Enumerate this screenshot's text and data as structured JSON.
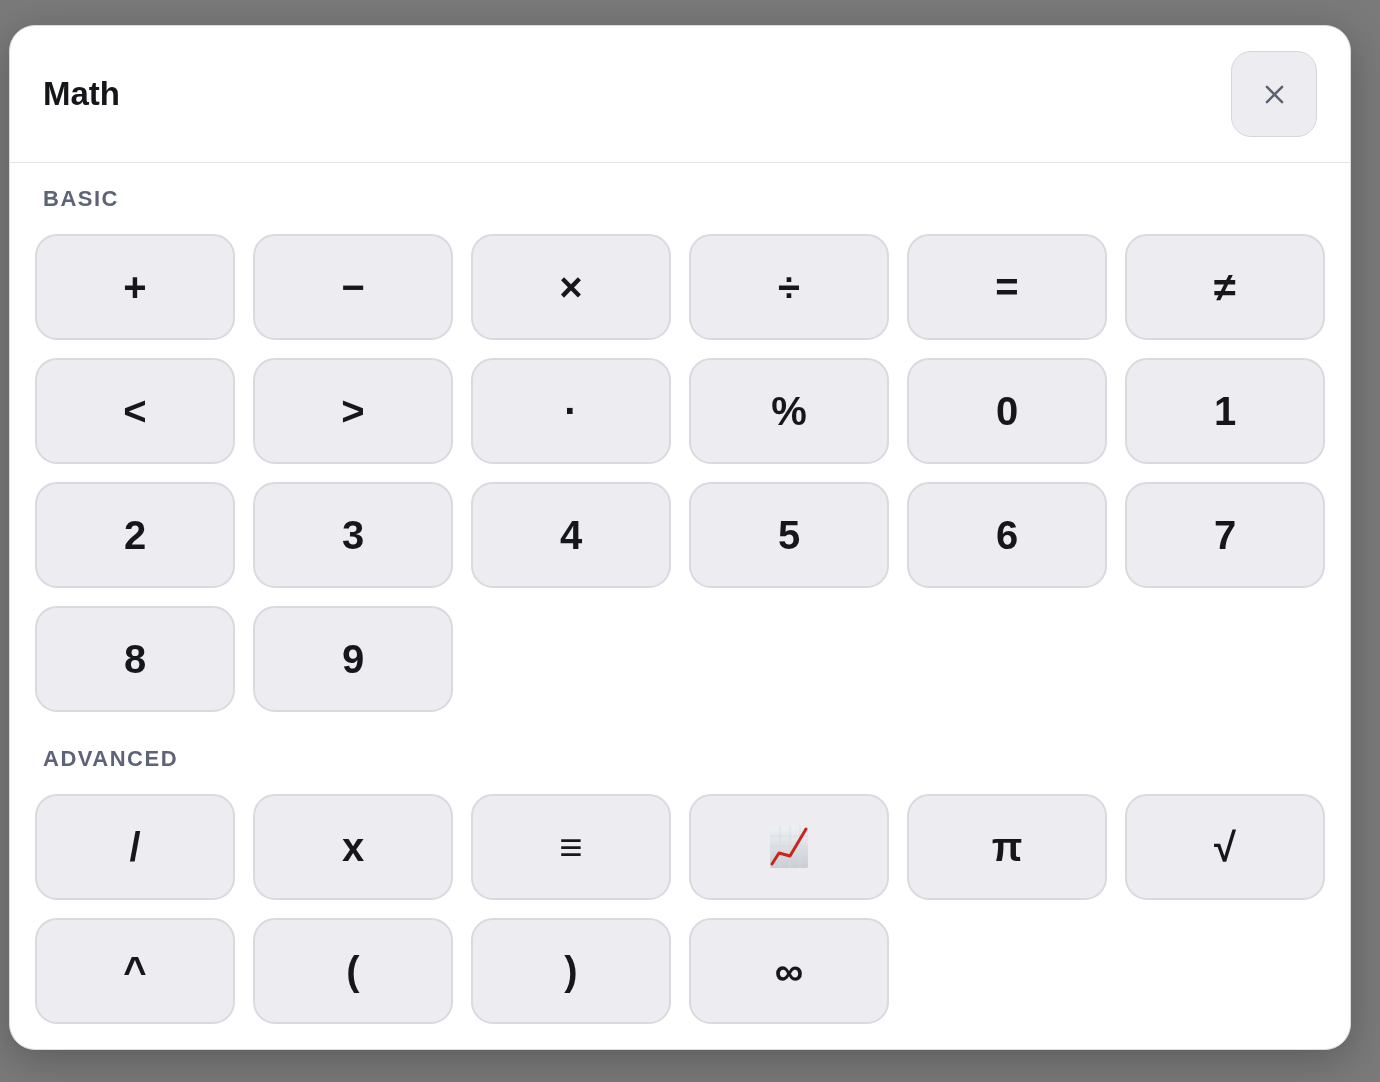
{
  "dialog": {
    "title": "Math"
  },
  "sections": [
    {
      "heading": "BASIC",
      "keys": [
        {
          "kind": "text",
          "label": "+"
        },
        {
          "kind": "text",
          "label": "−"
        },
        {
          "kind": "text",
          "label": "×"
        },
        {
          "kind": "text",
          "label": "÷"
        },
        {
          "kind": "text",
          "label": "="
        },
        {
          "kind": "text",
          "label": "≠"
        },
        {
          "kind": "text",
          "label": "<"
        },
        {
          "kind": "text",
          "label": ">"
        },
        {
          "kind": "text",
          "label": "·"
        },
        {
          "kind": "text",
          "label": "%"
        },
        {
          "kind": "text",
          "label": "0"
        },
        {
          "kind": "text",
          "label": "1"
        },
        {
          "kind": "text",
          "label": "2"
        },
        {
          "kind": "text",
          "label": "3"
        },
        {
          "kind": "text",
          "label": "4"
        },
        {
          "kind": "text",
          "label": "5"
        },
        {
          "kind": "text",
          "label": "6"
        },
        {
          "kind": "text",
          "label": "7"
        },
        {
          "kind": "text",
          "label": "8"
        },
        {
          "kind": "text",
          "label": "9"
        }
      ]
    },
    {
      "heading": "ADVANCED",
      "keys": [
        {
          "kind": "text",
          "label": "/"
        },
        {
          "kind": "text",
          "label": "x"
        },
        {
          "kind": "text",
          "label": "≡"
        },
        {
          "kind": "icon"
        },
        {
          "kind": "text",
          "label": "π"
        },
        {
          "kind": "text",
          "label": "√"
        },
        {
          "kind": "text",
          "label": "^"
        },
        {
          "kind": "text",
          "label": "("
        },
        {
          "kind": "text",
          "label": ")"
        },
        {
          "kind": "text",
          "label": "∞"
        }
      ]
    }
  ]
}
